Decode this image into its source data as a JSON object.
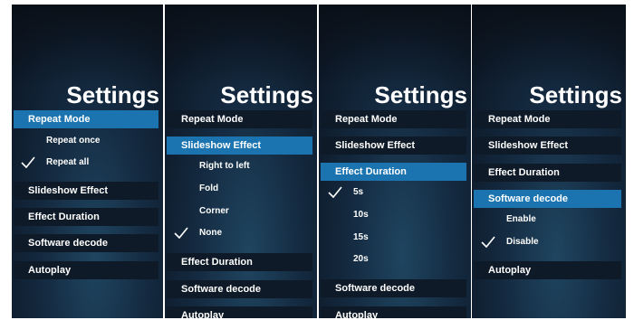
{
  "panels": [
    {
      "title": "Settings",
      "menu": [
        "Repeat Mode",
        "Slideshow Effect",
        "Effect Duration",
        "Software decode",
        "Autoplay"
      ],
      "active": "Repeat Mode",
      "options": [
        "Repeat once",
        "Repeat all"
      ],
      "selected": "Repeat all"
    },
    {
      "title": "Settings",
      "menu": [
        "Repeat Mode",
        "Slideshow Effect",
        "Effect Duration",
        "Software decode",
        "Autoplay"
      ],
      "active": "Slideshow Effect",
      "options": [
        "Right to left",
        "Fold",
        "Corner",
        "None"
      ],
      "selected": "None"
    },
    {
      "title": "Settings",
      "menu": [
        "Repeat Mode",
        "Slideshow Effect",
        "Effect Duration",
        "Software decode",
        "Autoplay"
      ],
      "active": "Effect Duration",
      "options": [
        "5s",
        "10s",
        "15s",
        "20s"
      ],
      "selected": "5s"
    },
    {
      "title": "Settings",
      "menu": [
        "Repeat Mode",
        "Slideshow Effect",
        "Effect Duration",
        "Software decode",
        "Autoplay"
      ],
      "active": "Software decode",
      "options": [
        "Enable",
        "Disable"
      ],
      "selected": "Disable"
    }
  ],
  "colors": {
    "highlight": "#1b74b0",
    "row_bg": "#0e1a27",
    "text": "#ffffff"
  },
  "icons": {
    "selected_marker": "check-icon"
  }
}
